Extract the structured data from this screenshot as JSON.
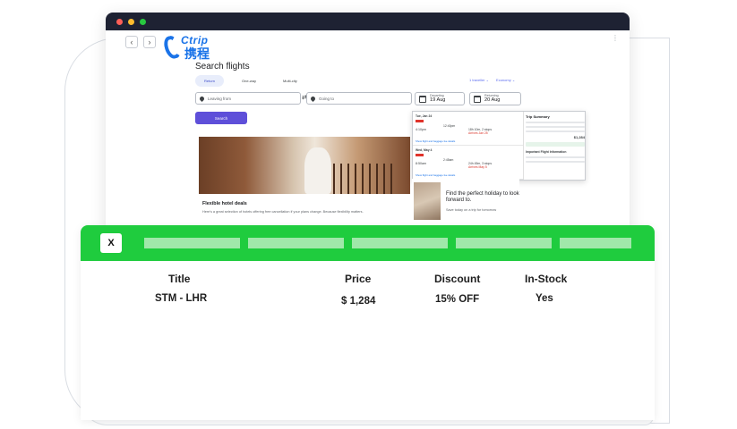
{
  "browser": {
    "nav_back": "‹",
    "nav_forward": "›",
    "menu_glyph": "⋮"
  },
  "logo": {
    "en": "Ctrip",
    "cn": "携程"
  },
  "search": {
    "title": "Search flights",
    "tabs": [
      {
        "label": "Return",
        "active": true
      },
      {
        "label": "One-way",
        "active": false
      },
      {
        "label": "Multi-city",
        "active": false
      }
    ],
    "traveller": "1 traveller ⌄",
    "cabin": "Economy ⌄",
    "from_placeholder": "Leaving from",
    "to_placeholder": "Going to",
    "departing_label": "Departing",
    "departing_value": "19 Aug",
    "returning_label": "Returning",
    "returning_value": "20 Aug",
    "button": "Search"
  },
  "hotel": {
    "title": "Flexible hotel deals",
    "description": "Here's a great selection of hotels offering free cancellation if your plans change. Because flexibility matters."
  },
  "flights_popup": {
    "rows": [
      {
        "date": "Tue, Jan 24",
        "depart": "4:10pm",
        "arrive": "12:40pm",
        "duration": "18h 10m, 2 stops",
        "note": "Arrives Jan 25"
      },
      {
        "date": "Wed, May 4",
        "depart": "8:50am",
        "arrive": "2:45am",
        "duration": "24h 45m, 3 stops",
        "note": "Arrives May 5"
      }
    ],
    "link": "Show flight and baggage fee details",
    "summary_title": "Trip Summary",
    "price": "$1,284",
    "info_title": "Important Flight Information"
  },
  "promo": {
    "title": "Find the perfect holiday to look forward to.",
    "subtitle": "Save today on a trip for tomorrow"
  },
  "panel": {
    "close_label": "X",
    "headers": {
      "title": "Title",
      "price": "Price",
      "discount": "Discount",
      "stock": "In-Stock"
    },
    "row": {
      "title": "STM - LHR",
      "price": "$ 1,284",
      "discount": "15% OFF",
      "stock": "Yes"
    }
  },
  "colors": {
    "accent_green": "#1fcc3e",
    "search_button": "#5e4fd9",
    "brand_blue": "#1a73e8"
  }
}
